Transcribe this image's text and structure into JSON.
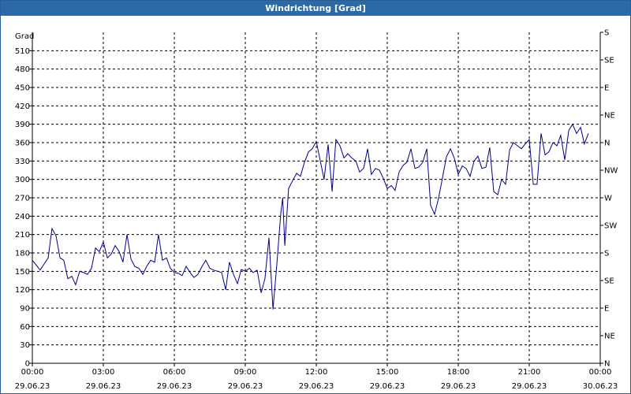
{
  "window": {
    "title": "Windrichtung [Grad]"
  },
  "chart_data": {
    "type": "line",
    "title": "Windrichtung [Grad]",
    "ylabel": "Grad",
    "ylim": [
      0,
      540
    ],
    "yticks": [
      0,
      30,
      60,
      90,
      120,
      150,
      180,
      210,
      240,
      270,
      300,
      330,
      360,
      390,
      420,
      450,
      480,
      510
    ],
    "xlim": [
      "29.06.23 00:00",
      "30.06.23 00:00"
    ],
    "xticks": [
      {
        "time": "00:00",
        "date": "29.06.23"
      },
      {
        "time": "03:00",
        "date": "29.06.23"
      },
      {
        "time": "06:00",
        "date": "29.06.23"
      },
      {
        "time": "09:00",
        "date": "29.06.23"
      },
      {
        "time": "12:00",
        "date": "29.06.23"
      },
      {
        "time": "15:00",
        "date": "29.06.23"
      },
      {
        "time": "18:00",
        "date": "29.06.23"
      },
      {
        "time": "21:00",
        "date": "29.06.23"
      },
      {
        "time": "00:00",
        "date": "30.06.23"
      }
    ],
    "right_axis_labels": [
      {
        "value": 0,
        "label": "N"
      },
      {
        "value": 45,
        "label": "NE"
      },
      {
        "value": 90,
        "label": "E"
      },
      {
        "value": 135,
        "label": "SE"
      },
      {
        "value": 180,
        "label": "S"
      },
      {
        "value": 225,
        "label": "SW"
      },
      {
        "value": 270,
        "label": "W"
      },
      {
        "value": 315,
        "label": "NW"
      },
      {
        "value": 360,
        "label": "N"
      },
      {
        "value": 405,
        "label": "NE"
      },
      {
        "value": 450,
        "label": "E"
      },
      {
        "value": 495,
        "label": "SE"
      },
      {
        "value": 540,
        "label": "S"
      }
    ],
    "grid": true,
    "colors": {
      "line": "#00008b",
      "grid": "#000000"
    },
    "series": [
      {
        "x_hours": [
          0.0,
          0.17,
          0.33,
          0.5,
          0.67,
          0.83,
          1.0,
          1.17,
          1.33,
          1.5,
          1.67,
          1.83,
          2.0,
          2.17,
          2.33,
          2.5,
          2.67,
          2.83,
          3.0,
          3.17,
          3.33,
          3.5,
          3.67,
          3.83,
          4.0,
          4.17,
          4.33,
          4.5,
          4.67,
          4.83,
          5.0,
          5.17,
          5.33,
          5.5,
          5.67,
          5.83,
          6.0,
          6.17,
          6.33,
          6.5,
          6.67,
          6.83,
          7.0,
          7.17,
          7.33,
          7.5,
          7.67,
          7.83,
          8.0,
          8.17,
          8.33,
          8.5,
          8.67,
          8.83,
          9.0,
          9.17,
          9.33,
          9.5,
          9.67,
          9.83,
          10.0,
          10.17,
          10.33,
          10.5,
          10.58,
          10.67,
          10.83,
          11.0,
          11.17,
          11.33,
          11.5,
          11.67,
          11.83,
          12.0,
          12.17,
          12.33,
          12.5,
          12.67,
          12.83,
          13.0,
          13.17,
          13.33,
          13.5,
          13.67,
          13.83,
          14.0,
          14.17,
          14.33,
          14.5,
          14.67,
          14.83,
          15.0,
          15.17,
          15.33,
          15.5,
          15.67,
          15.83,
          16.0,
          16.17,
          16.33,
          16.5,
          16.67,
          16.83,
          17.0,
          17.17,
          17.33,
          17.5,
          17.67,
          17.83,
          18.0,
          18.17,
          18.33,
          18.5,
          18.67,
          18.83,
          19.0,
          19.17,
          19.33,
          19.5,
          19.67,
          19.83,
          20.0,
          20.17,
          20.33,
          20.5,
          20.67,
          20.83,
          21.0,
          21.17,
          21.33,
          21.5,
          21.67,
          21.83,
          22.0,
          22.17,
          22.33,
          22.5,
          22.67,
          22.83,
          23.0,
          23.17,
          23.33,
          23.5,
          23.67,
          23.83,
          24.0
        ],
        "values": [
          168,
          160,
          152,
          162,
          172,
          220,
          208,
          172,
          168,
          138,
          142,
          128,
          150,
          148,
          145,
          155,
          188,
          182,
          198,
          172,
          178,
          192,
          182,
          165,
          210,
          170,
          158,
          155,
          145,
          158,
          168,
          165,
          210,
          168,
          172,
          155,
          148,
          147,
          143,
          158,
          148,
          140,
          145,
          158,
          168,
          155,
          152,
          150,
          148,
          120,
          165,
          145,
          130,
          153,
          150,
          155,
          148,
          152,
          115,
          138,
          205,
          88,
          160,
          245,
          270,
          192,
          285,
          298,
          310,
          305,
          328,
          345,
          350,
          362,
          330,
          300,
          357,
          280,
          365,
          355,
          335,
          342,
          335,
          330,
          312,
          318,
          350,
          308,
          318,
          315,
          302,
          285,
          290,
          282,
          312,
          323,
          328,
          350,
          318,
          320,
          328,
          350,
          258,
          243,
          270,
          302,
          337,
          350,
          335,
          308,
          322,
          318,
          305,
          330,
          338,
          318,
          320,
          352,
          280,
          275,
          300,
          292,
          348,
          360,
          355,
          350,
          358,
          365,
          292,
          292,
          375,
          340,
          345,
          360,
          355,
          372,
          332,
          380,
          390,
          375,
          385,
          358,
          375
        ]
      }
    ]
  }
}
